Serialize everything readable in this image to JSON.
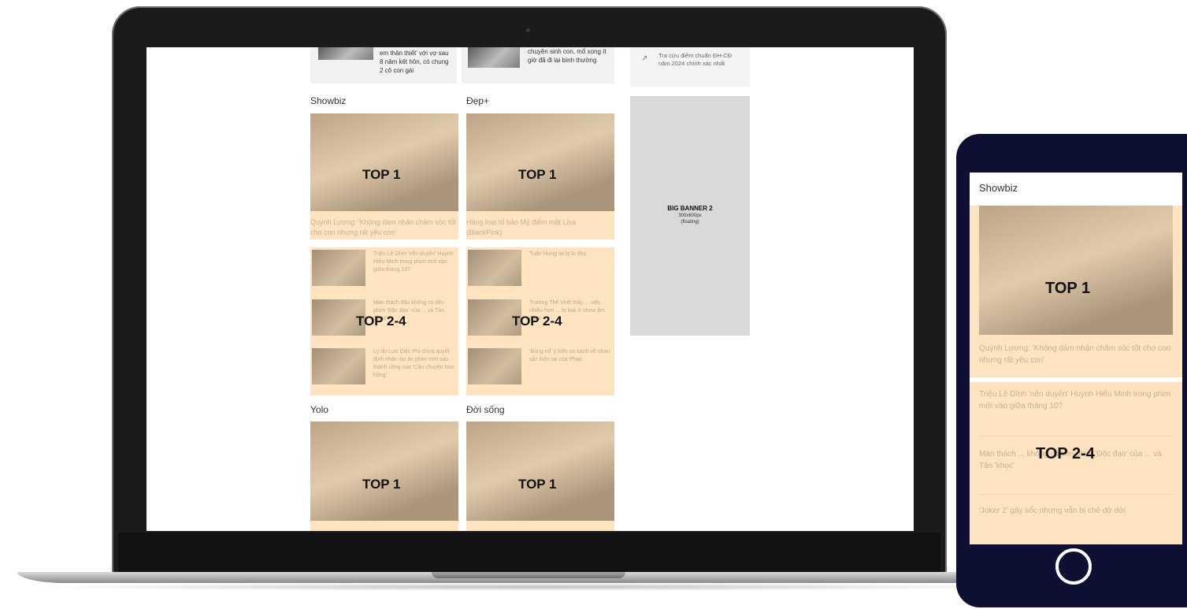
{
  "laptop": {
    "top_row": [
      {
        "text": "em thân thiết' với vợ sau 8 năm kết hôn, có chung 2 cô con gái"
      },
      {
        "text": "chuyện sinh con, mổ xong ít giờ đã đi lại bình thường"
      }
    ],
    "sidebar_link": {
      "text": "Tra cứu điểm chuẩn ĐH-CĐ năm 2024 chính xác nhất"
    },
    "banner": {
      "title": "BIG BANNER 2",
      "size": "300x600px",
      "note": "(floating)"
    },
    "sections": [
      {
        "title": "Showbiz",
        "top1_label": "TOP 1",
        "top1_caption": "Quỳnh Lương: 'Không dám nhận chăm sóc tốt cho con nhưng rất yêu con'",
        "top24_label": "TOP 2-4",
        "items": [
          "Triệu Lệ Dĩnh 'nên duyên' Huỳnh Hiểu Minh trong phim mới vào giữa tháng 10?",
          "Màn thách đấu không có tiền phim 'Độc đạo' của ... và Tân 'khọc'",
          "Lý do Lưu Diệc Phi chưa quyết định nhận dự án phim mới sau thành công của 'Câu chuyện hoa hồng'"
        ]
      },
      {
        "title": "Đẹp+",
        "top1_label": "TOP 1",
        "top1_caption": "Hàng loạt tổ bảo Mỹ điểm mặt Lisa (BlackPink)",
        "top24_label": "TOP 2-4",
        "items": [
          "Tuấn Hưng lại bị lo đẹp",
          "Trường Thế Vinh thấy ... việc nhiều hơn ... bị loại ở show âm nhạc",
          "'Bùng nổ' ý kiến so sánh về nhan sắc hiện tại của Pháo"
        ]
      },
      {
        "title": "Yolo",
        "top1_label": "TOP 1"
      },
      {
        "title": "Đời sống",
        "top1_label": "TOP 1"
      }
    ]
  },
  "phone": {
    "section_title": "Showbiz",
    "top1_label": "TOP 1",
    "top1_caption": "Quỳnh Lương: 'Không dám nhận chăm sóc tốt cho con nhưng rất yêu con'",
    "top24_label": "TOP 2-4",
    "items": [
      "Triệu Lệ Dĩnh 'nên duyên' Huỳnh Hiểu Minh trong phim mới vào giữa tháng 10?",
      "Màn thách ... không có tiền phim 'Độc đạo' của ... và Tân 'khọc'",
      "'Joker 2' gây sốc nhưng vẫn bị chê dở dời"
    ]
  },
  "colors": {
    "accent": "#fde3c0",
    "phone_frame": "#0e1033",
    "laptop_frame": "#1b1b1d"
  }
}
